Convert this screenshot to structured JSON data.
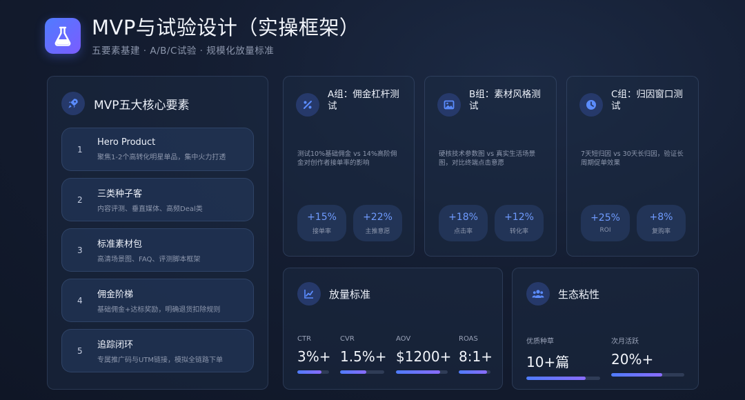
{
  "header": {
    "title": "MVP与试验设计（实操框架）",
    "subtitle": "五要素基建 · A/B/C试验 · 规模化放量标准",
    "icon": "flask-icon"
  },
  "elements_panel": {
    "title": "MVP五大核心要素",
    "icon": "rocket-icon",
    "items": [
      {
        "num": "1",
        "title": "Hero Product",
        "desc": "聚焦1-2个高转化明星单品，集中火力打透"
      },
      {
        "num": "2",
        "title": "三类种子客",
        "desc": "内容评测、垂直媒体、高频Deal类"
      },
      {
        "num": "3",
        "title": "标准素材包",
        "desc": "高清场景图、FAQ、评测脚本框架"
      },
      {
        "num": "4",
        "title": "佣金阶梯",
        "desc": "基础佣金+达标奖励，明确退货扣除规则"
      },
      {
        "num": "5",
        "title": "追踪闭环",
        "desc": "专属推广码与UTM链接，模拟全链路下单"
      }
    ]
  },
  "tests": [
    {
      "title": "A组：佣金杠杆测试",
      "icon": "percent-icon",
      "desc": "测试10%基础佣金 vs 14%高阶佣金对创作者接单率的影响",
      "metrics": [
        {
          "value": "+15%",
          "label": "接单率"
        },
        {
          "value": "+22%",
          "label": "主推意愿"
        }
      ]
    },
    {
      "title": "B组：素材风格测试",
      "icon": "image-icon",
      "desc": "硬核技术参数图 vs 真实生活场景图，对比终端点击意愿",
      "metrics": [
        {
          "value": "+18%",
          "label": "点击率"
        },
        {
          "value": "+12%",
          "label": "转化率"
        }
      ]
    },
    {
      "title": "C组：归因窗口测试",
      "icon": "clock-icon",
      "desc": "7天短归因 vs 30天长归因，验证长周期促单效果",
      "metrics": [
        {
          "value": "+25%",
          "label": "ROI"
        },
        {
          "value": "+8%",
          "label": "复购率"
        }
      ]
    }
  ],
  "scale": {
    "title": "放量标准",
    "icon": "line-chart-icon",
    "kpis": [
      {
        "label": "CTR",
        "value": "3%+",
        "fill": 0.75
      },
      {
        "label": "CVR",
        "value": "1.5%+",
        "fill": 0.6
      },
      {
        "label": "AOV",
        "value": "$1200+",
        "fill": 0.85
      },
      {
        "label": "ROAS",
        "value": "8:1+",
        "fill": 0.9
      }
    ]
  },
  "ecosystem": {
    "title": "生态粘性",
    "icon": "users-icon",
    "kpis": [
      {
        "label": "优质种草",
        "value": "10+篇",
        "fill": 0.8
      },
      {
        "label": "次月活跃",
        "value": "20%+",
        "fill": 0.7
      }
    ]
  },
  "colors": {
    "accent": "#6f9bff",
    "card_border": "#3a4a6a",
    "background": "#141d31"
  }
}
